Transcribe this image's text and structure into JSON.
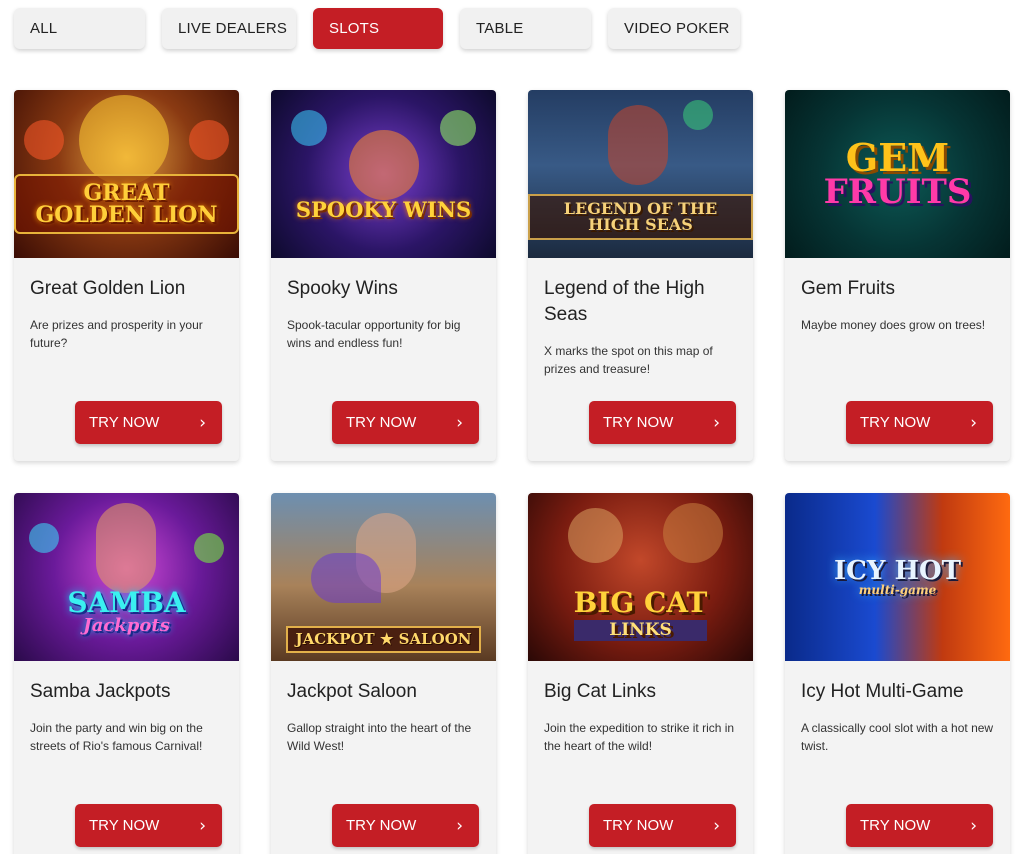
{
  "filters": [
    {
      "label": "ALL",
      "active": false
    },
    {
      "label": "LIVE DEALERS",
      "active": false
    },
    {
      "label": "SLOTS",
      "active": true
    },
    {
      "label": "TABLE",
      "active": false
    },
    {
      "label": "VIDEO POKER",
      "active": false
    }
  ],
  "games": [
    {
      "title": "Great Golden Lion",
      "description": "Are prizes and prosperity in your future?",
      "button": "TRY NOW",
      "logo": "GREAT GOLDEN LION"
    },
    {
      "title": "Spooky Wins",
      "description": "Spook-tacular opportunity for big wins and endless fun!",
      "button": "TRY NOW",
      "logo": "SPOOKY WINS"
    },
    {
      "title": "Legend of the High Seas",
      "description": "X marks the spot on this map of prizes and treasure!",
      "button": "TRY NOW",
      "logo": "LEGEND OF THE HIGH SEAS"
    },
    {
      "title": "Gem Fruits",
      "description": "Maybe money does grow on trees!",
      "button": "TRY NOW",
      "logo_top": "GEM",
      "logo_bottom": "FRUITS"
    },
    {
      "title": "Samba Jackpots",
      "description": "Join the party and win big on the streets of Rio's famous Carnival!",
      "button": "TRY NOW",
      "logo_top": "SAMBA",
      "logo_bottom": "Jackpots"
    },
    {
      "title": "Jackpot Saloon",
      "description": "Gallop straight into the heart of the Wild West!",
      "button": "TRY NOW",
      "logo": "JACKPOT ★ SALOON"
    },
    {
      "title": "Big Cat Links",
      "description": "Join the expedition to strike it rich in the heart of the wild!",
      "button": "TRY NOW",
      "logo_top": "BIG CAT",
      "logo_bottom": "LINKS"
    },
    {
      "title": "Icy Hot Multi-Game",
      "description": "A classically cool slot with a hot new twist.",
      "button": "TRY NOW",
      "logo_top": "ICY HOT",
      "logo_bottom": "multi-game"
    }
  ],
  "colors": {
    "accent": "#c41e25",
    "card_bg": "#f3f3f3",
    "tab_bg": "#f1f1f1"
  },
  "icons": {
    "button_icon": "chevron-right-icon"
  }
}
